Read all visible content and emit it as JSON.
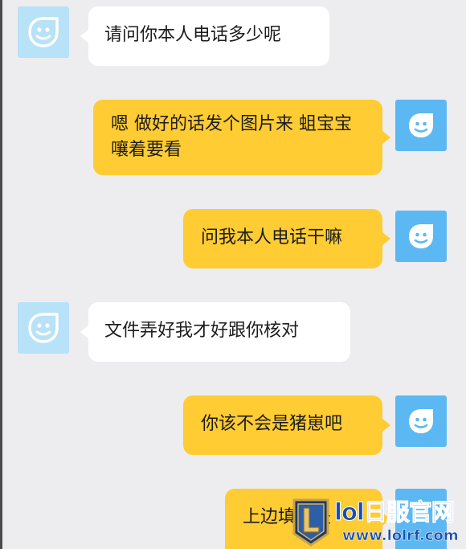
{
  "messages": [
    {
      "side": "received",
      "text": "请问你本人电话多少呢"
    },
    {
      "side": "sent",
      "text": "嗯 做好的话发个图片来 蛆宝宝嚷着要看"
    },
    {
      "side": "sent",
      "text": "问我本人电话干嘛"
    },
    {
      "side": "received",
      "text": "文件弄好我才好跟你核对"
    },
    {
      "side": "sent",
      "text": "你该不会是猪崽吧"
    },
    {
      "side": "sent",
      "text": "上边填就是"
    }
  ],
  "watermark": {
    "title": "lol日服官网",
    "url": "www.lolrf.com"
  },
  "colors": {
    "background": "#ededf0",
    "received_bubble": "#ffffff",
    "sent_bubble": "#ffcc33",
    "received_avatar": "#b7e2f8",
    "sent_avatar": "#5cb8f2"
  },
  "icons": {
    "received_avatar": "chat-bot-avatar-icon",
    "sent_avatar": "chat-bot-avatar-icon"
  }
}
